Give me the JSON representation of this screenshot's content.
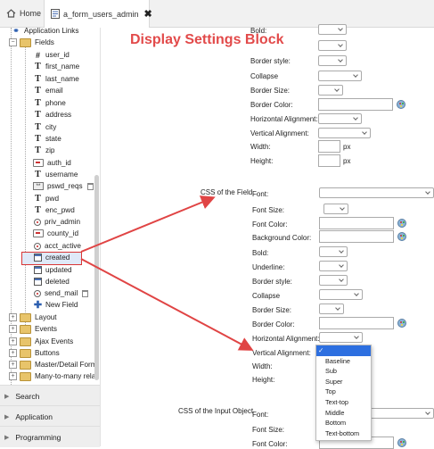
{
  "tabs": {
    "home_label": "Home",
    "form_label": "a_form_users_admin"
  },
  "banner": "Display Settings Block",
  "tree": {
    "top_items": [
      {
        "label": "Application Links"
      },
      {
        "label": "Fields"
      }
    ],
    "fields": [
      {
        "label": "user_id",
        "icon": "hash-icon"
      },
      {
        "label": "first_name",
        "icon": "text-icon"
      },
      {
        "label": "last_name",
        "icon": "text-icon"
      },
      {
        "label": "email",
        "icon": "text-icon"
      },
      {
        "label": "phone",
        "icon": "text-icon"
      },
      {
        "label": "address",
        "icon": "text-icon"
      },
      {
        "label": "city",
        "icon": "text-icon"
      },
      {
        "label": "state",
        "icon": "text-icon"
      },
      {
        "label": "zip",
        "icon": "text-icon"
      },
      {
        "label": "auth_id",
        "icon": "field-icon"
      },
      {
        "label": "username",
        "icon": "text-icon"
      },
      {
        "label": "pswd_reqs",
        "icon": "password-icon"
      },
      {
        "label": "pwd",
        "icon": "text-icon"
      },
      {
        "label": "enc_pwd",
        "icon": "text-icon"
      },
      {
        "label": "priv_admin",
        "icon": "radio-icon"
      },
      {
        "label": "county_id",
        "icon": "field-icon"
      },
      {
        "label": "acct_active",
        "icon": "radio-icon"
      },
      {
        "label": "created",
        "icon": "calendar-icon"
      },
      {
        "label": "updated",
        "icon": "calendar-icon"
      },
      {
        "label": "deleted",
        "icon": "calendar-icon"
      },
      {
        "label": "send_mail",
        "icon": "radio-icon"
      },
      {
        "label": "New Field",
        "icon": "plus-icon"
      }
    ],
    "bottom_items": [
      {
        "label": "Layout"
      },
      {
        "label": "Events"
      },
      {
        "label": "Ajax Events"
      },
      {
        "label": "Buttons"
      },
      {
        "label": "Master/Detail Form"
      },
      {
        "label": "Many-to-many relat"
      }
    ],
    "selected": "created"
  },
  "accordion": [
    {
      "label": "Search"
    },
    {
      "label": "Application"
    },
    {
      "label": "Programming"
    }
  ],
  "settings": {
    "bold_label": "Bold:",
    "border_style_label": "Border style:",
    "collapse_label": "Collapse",
    "border_size_label": "Border Size:",
    "border_color_label": "Border Color:",
    "horizontal_alignment_label": "Horizontal Alignment:",
    "vertical_alignment_label": "Vertical Alignment:",
    "width_label": "Width:",
    "height_label": "Height:",
    "px_unit": "px",
    "css_field_label": "CSS of the Field",
    "font_label": "Font:",
    "font_size_label": "Font Size:",
    "font_color_label": "Font Color:",
    "background_color_label": "Background Color:",
    "underline_label": "Underline:",
    "css_input_label": "CSS of the Input Object"
  },
  "vertical_alignment_options": [
    "",
    "Baseline",
    "Sub",
    "Super",
    "Top",
    "Text-top",
    "Middle",
    "Bottom",
    "Text-bottom"
  ],
  "vertical_alignment_selected": ""
}
